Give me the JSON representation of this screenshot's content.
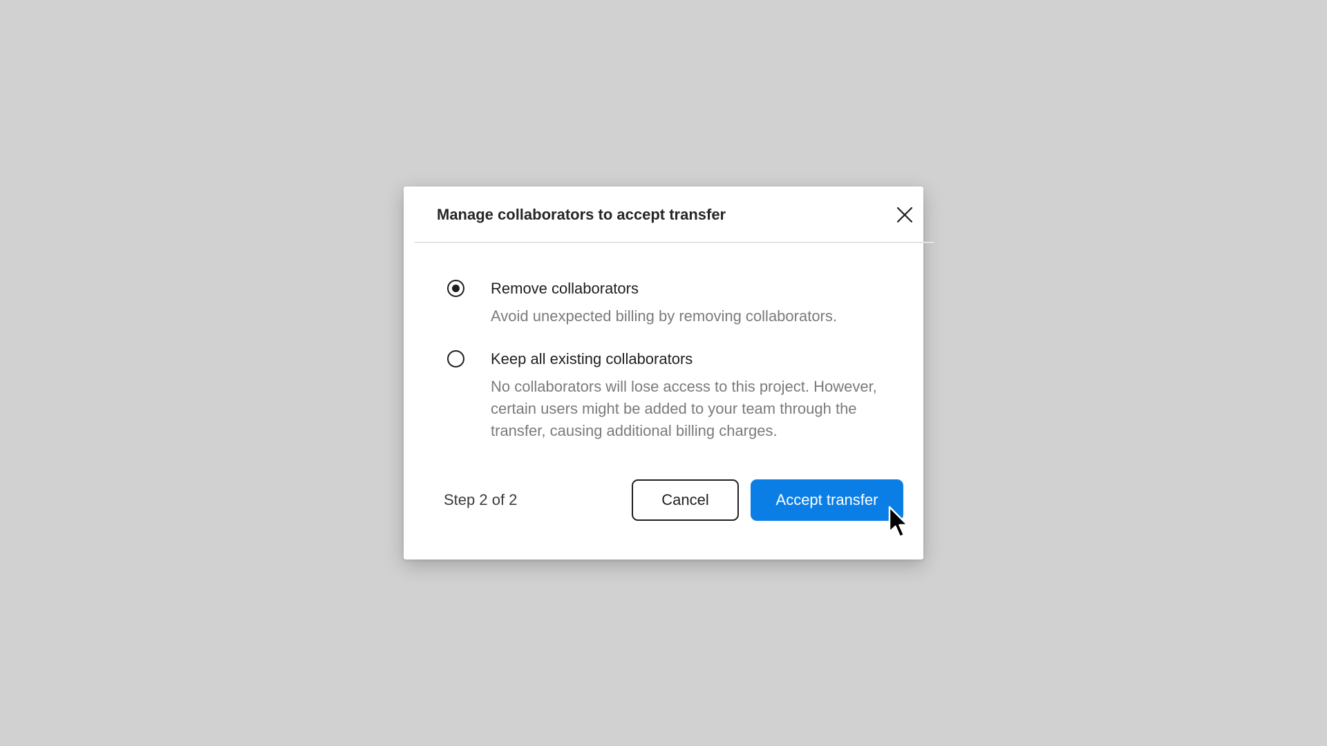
{
  "dialog": {
    "title": "Manage collaborators to accept transfer",
    "close_icon": "close-icon"
  },
  "options": [
    {
      "label": "Remove collaborators",
      "description": "Avoid unexpected billing by removing collaborators.",
      "selected": true
    },
    {
      "label": "Keep all existing collaborators",
      "description": "No collaborators will lose access to this project. However, certain users might be added to your team through the transfer, causing additional billing charges.",
      "selected": false
    }
  ],
  "footer": {
    "step": "Step 2 of 2",
    "cancel_label": "Cancel",
    "accept_label": "Accept transfer"
  },
  "colors": {
    "accent": "#0b7ee6",
    "backdrop": "#d1d1d1"
  }
}
